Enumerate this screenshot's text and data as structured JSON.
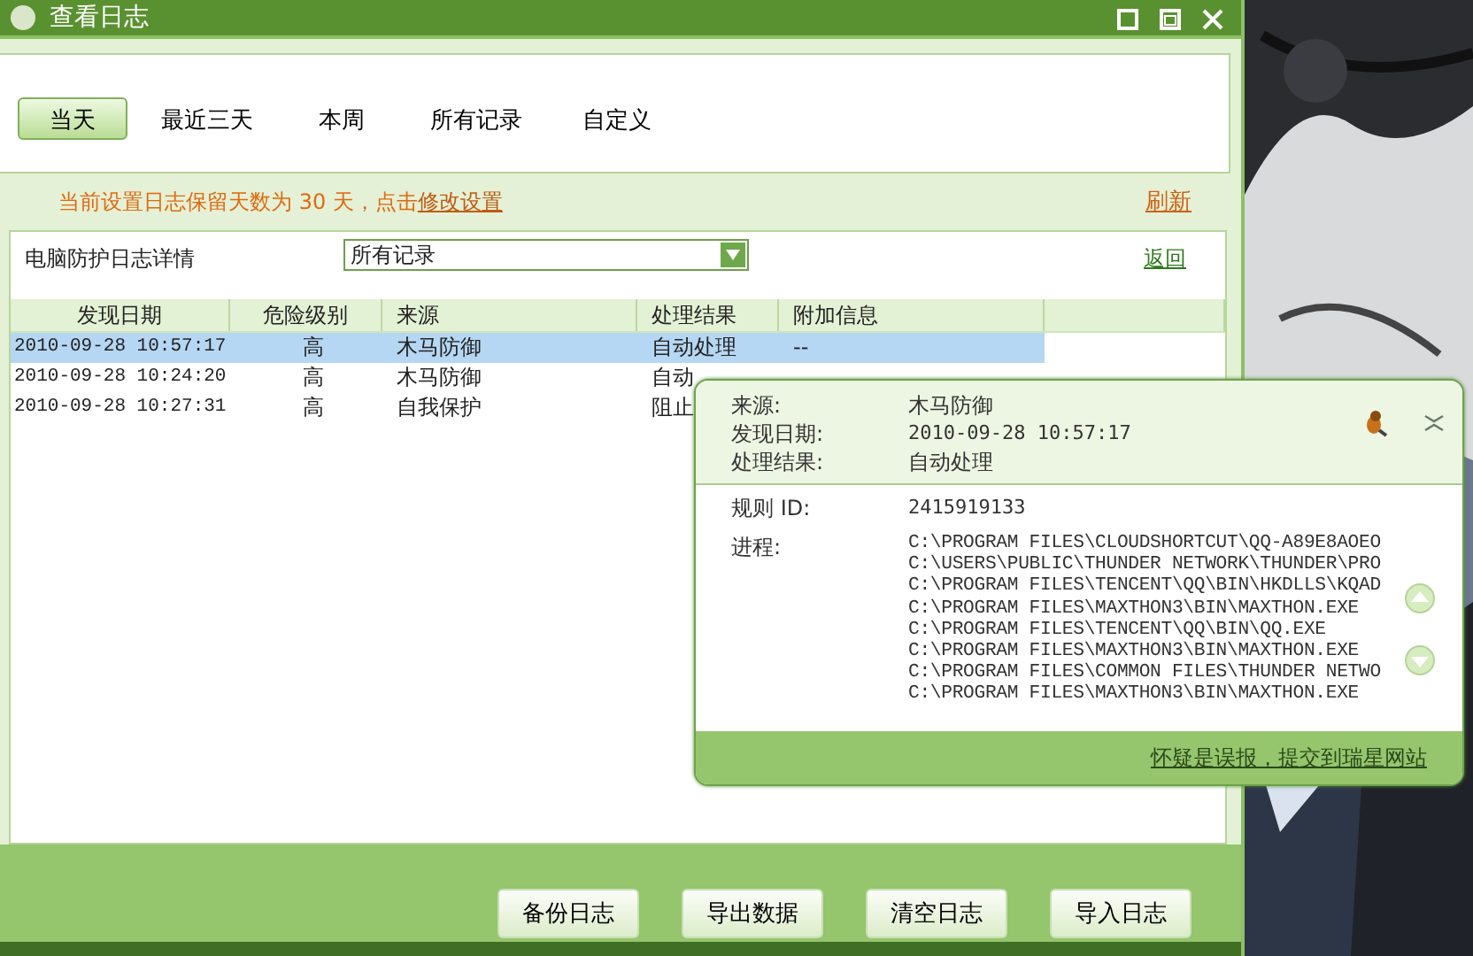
{
  "window": {
    "title": "查看日志"
  },
  "tabs": [
    {
      "label": "当天",
      "selected": true
    },
    {
      "label": "最近三天",
      "selected": false
    },
    {
      "label": "本周",
      "selected": false
    },
    {
      "label": "所有记录",
      "selected": false
    },
    {
      "label": "自定义",
      "selected": false
    }
  ],
  "notice": {
    "text": "当前设置日志保留天数为 30 天，点击",
    "link": "修改设置",
    "refresh": "刷新"
  },
  "panel": {
    "title": "电脑防护日志详情",
    "filter": "所有记录",
    "back": "返回"
  },
  "table": {
    "columns": [
      "发现日期",
      "危险级别",
      "来源",
      "处理结果",
      "附加信息"
    ],
    "rows": [
      {
        "cells": [
          "2010-09-28 10:57:17",
          "高",
          "木马防御",
          "自动处理",
          "--"
        ],
        "selected": true
      },
      {
        "cells": [
          "2010-09-28 10:24:20",
          "高",
          "木马防御",
          "自动"
        ],
        "selected": false
      },
      {
        "cells": [
          "2010-09-28 10:27:31",
          "高",
          "自我保护",
          "阻止"
        ],
        "selected": false
      }
    ]
  },
  "popup": {
    "fields": [
      {
        "label": "来源:",
        "value": "木马防御"
      },
      {
        "label": "发现日期:",
        "value": "2010-09-28 10:57:17"
      },
      {
        "label": "处理结果:",
        "value": "自动处理"
      }
    ],
    "rule": {
      "label": "规则 ID:",
      "value": "2415919133"
    },
    "process": {
      "label": "进程:",
      "lines": [
        "C:\\PROGRAM FILES\\CLOUDSHORTCUT\\QQ-A89E8AOEO",
        "C:\\USERS\\PUBLIC\\THUNDER NETWORK\\THUNDER\\PRO",
        "C:\\PROGRAM FILES\\TENCENT\\QQ\\BIN\\HKDLLS\\KQAD",
        "C:\\PROGRAM FILES\\MAXTHON3\\BIN\\MAXTHON.EXE",
        "C:\\PROGRAM FILES\\TENCENT\\QQ\\BIN\\QQ.EXE",
        "C:\\PROGRAM FILES\\MAXTHON3\\BIN\\MAXTHON.EXE",
        "C:\\PROGRAM FILES\\COMMON FILES\\THUNDER NETWO",
        "C:\\PROGRAM FILES\\MAXTHON3\\BIN\\MAXTHON.EXE"
      ]
    },
    "report_link": "怀疑是误报，提交到瑞星网站"
  },
  "buttons": [
    "备份日志",
    "导出数据",
    "清空日志",
    "导入日志"
  ]
}
